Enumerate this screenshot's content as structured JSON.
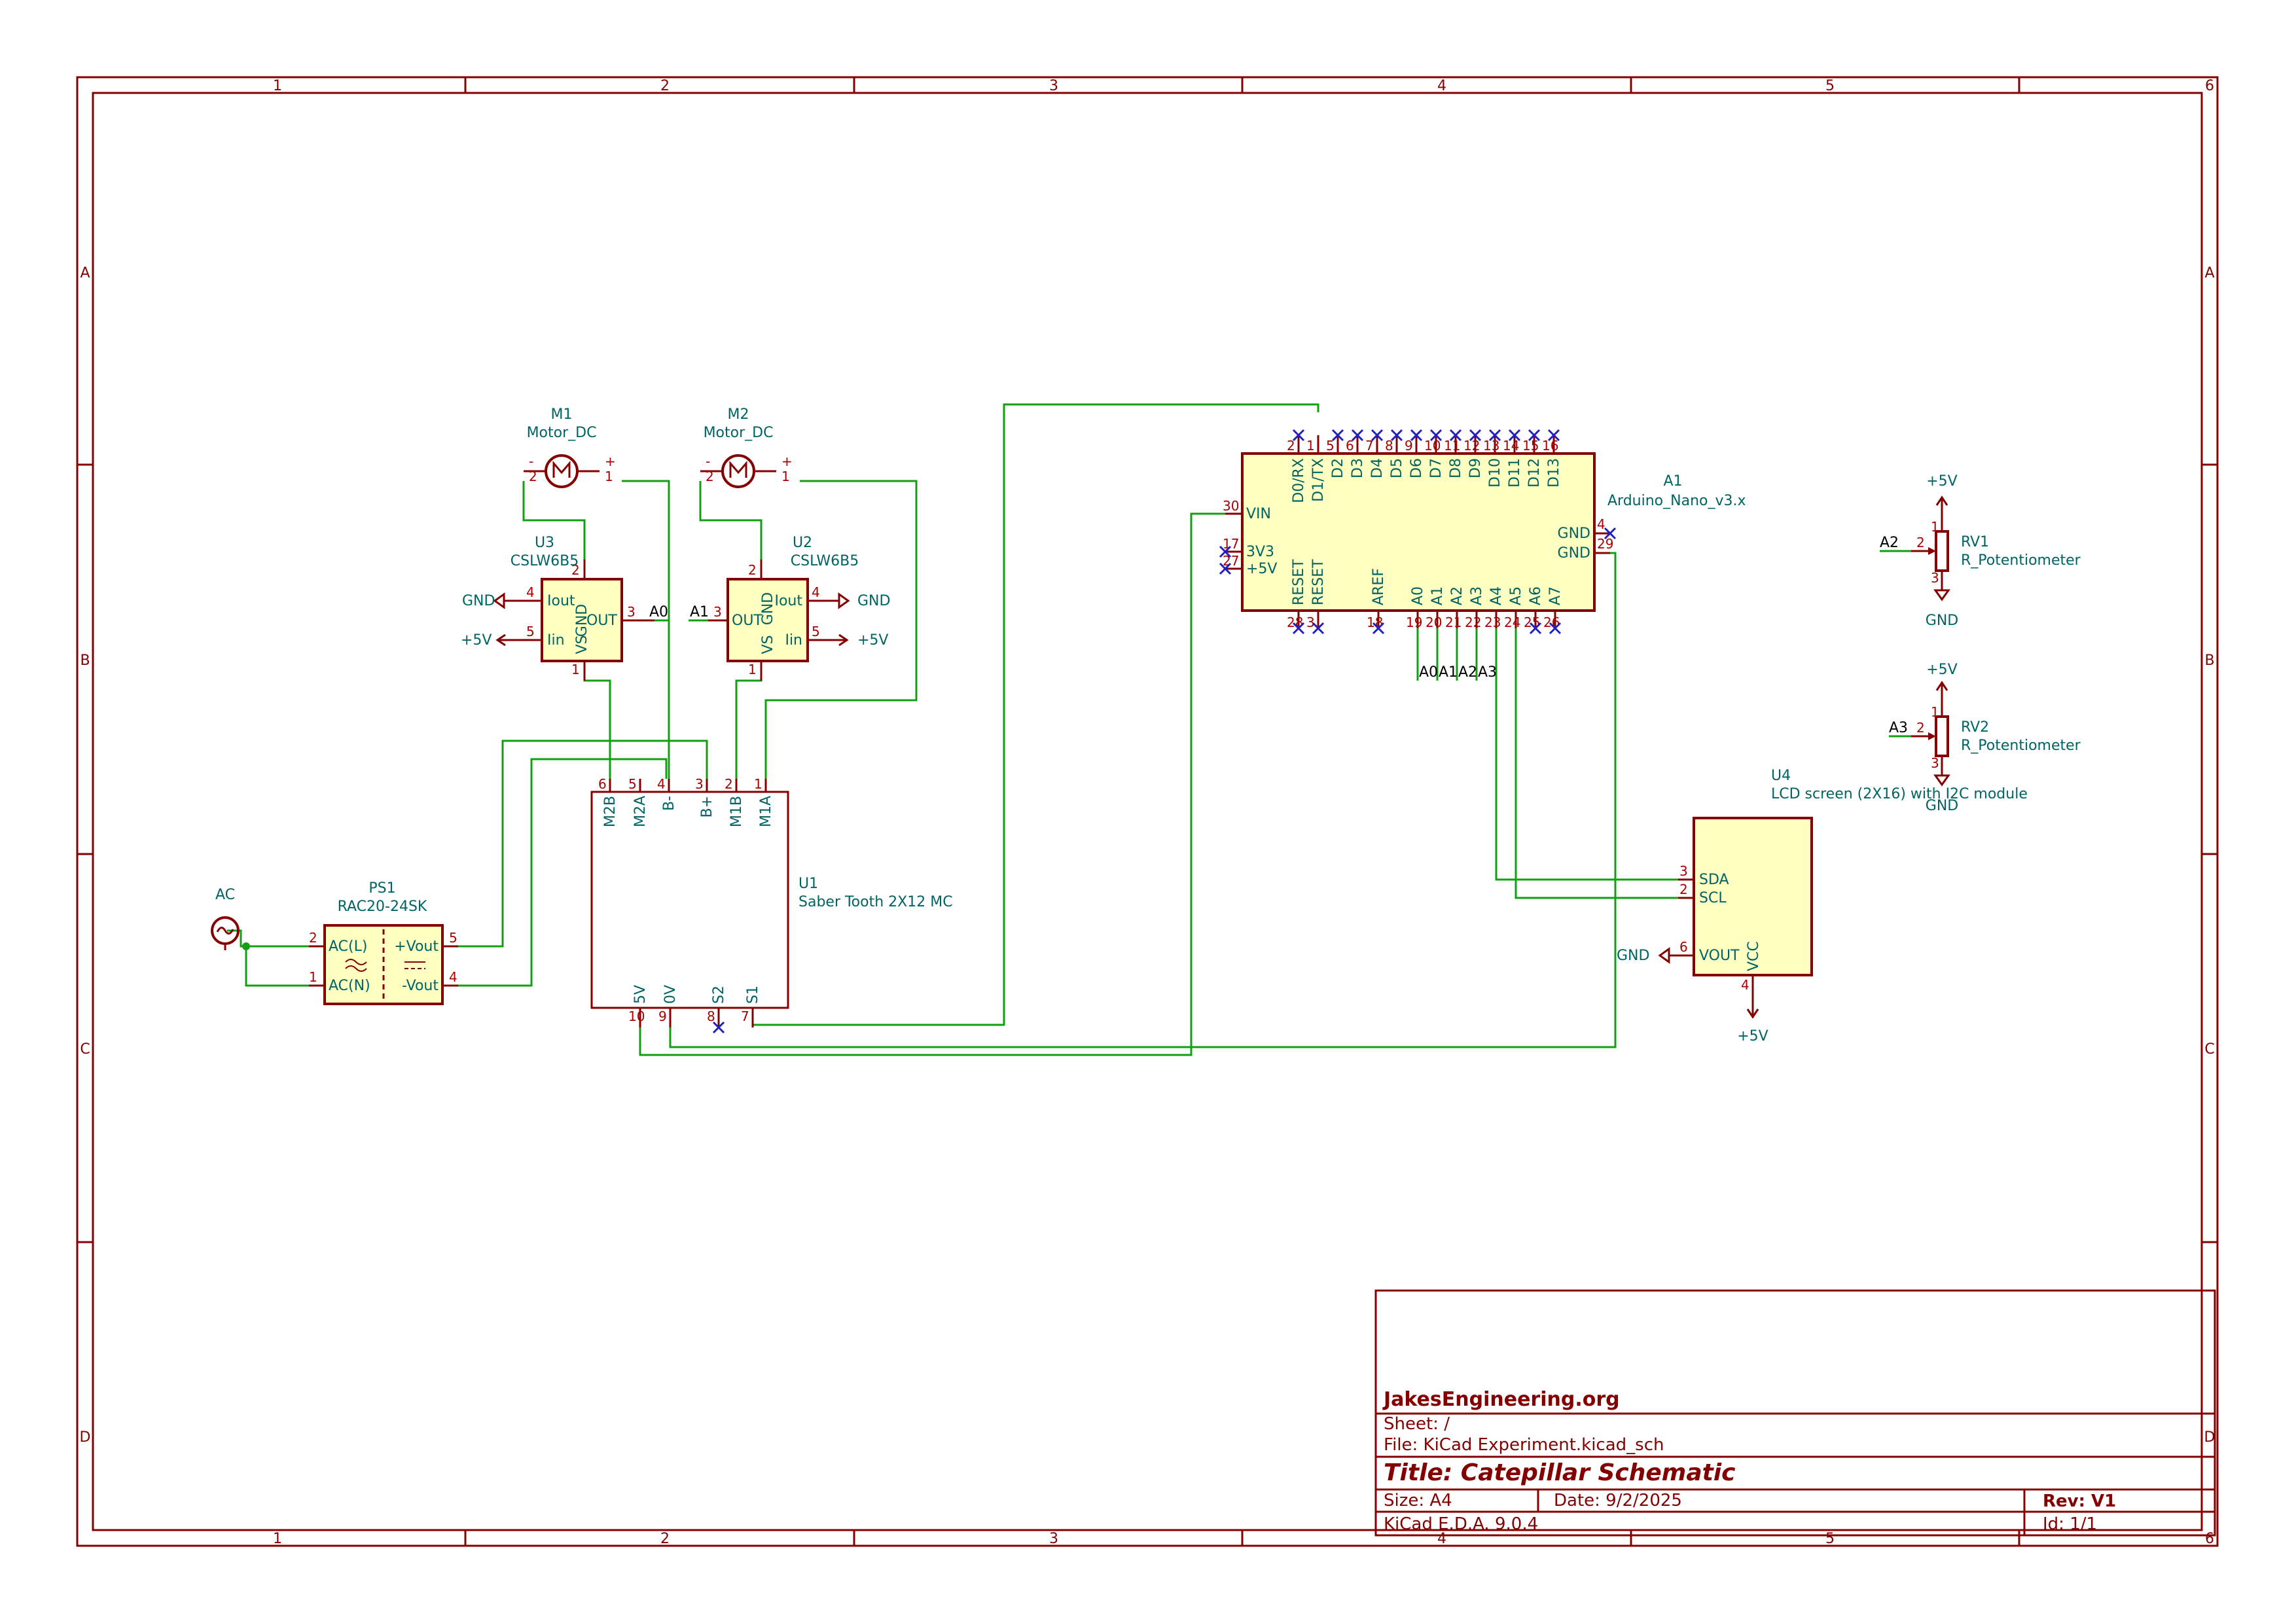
{
  "frame": {
    "columns": [
      "1",
      "2",
      "3",
      "4",
      "5",
      "6"
    ],
    "rows": [
      "A",
      "B",
      "C",
      "D"
    ]
  },
  "title_block": {
    "company": "JakesEngineering.org",
    "sheet": "Sheet: /",
    "file": "File: KiCad Experiment.kicad_sch",
    "title": "Title: Catepillar Schematic",
    "size": "Size: A4",
    "date": "Date: 9/2/2025",
    "rev": "Rev: V1",
    "tool": "KiCad E.D.A. 9.0.4",
    "id": "Id: 1/1"
  },
  "components": {
    "m1": {
      "ref": "M1",
      "value": "Motor_DC",
      "pins": {
        "minus": "2",
        "plus": "1"
      }
    },
    "m2": {
      "ref": "M2",
      "value": "Motor_DC",
      "pins": {
        "minus": "2",
        "plus": "1"
      }
    },
    "u3": {
      "ref": "U3",
      "value": "CSLW6B5",
      "pins": {
        "iout": "Iout",
        "iin": "Iin",
        "gnd": "GND",
        "vs": "VS",
        "out": "OUT"
      }
    },
    "u2": {
      "ref": "U2",
      "value": "CSLW6B5",
      "pins": {
        "iout": "Iout",
        "iin": "Iin",
        "gnd": "GND",
        "vs": "VS",
        "out": "OUT"
      }
    },
    "ps1": {
      "ref": "PS1",
      "value": "RAC20-24SK",
      "pins": {
        "acl": "AC(L)",
        "acn": "AC(N)",
        "vplus": "+Vout",
        "vminus": "-Vout"
      }
    },
    "ac": {
      "ref": "AC"
    },
    "u1": {
      "ref": "U1",
      "value": "Saber Tooth 2X12 MC",
      "top_pins": [
        "M2B",
        "M2A",
        "B-",
        "B+",
        "M1B",
        "M1A"
      ],
      "top_nums": [
        "6",
        "5",
        "4",
        "3",
        "2",
        "1"
      ],
      "bottom_pins": [
        "5V",
        "0V",
        "S2",
        "S1"
      ],
      "bottom_nums": [
        "10",
        "9",
        "8",
        "7"
      ]
    },
    "a1": {
      "ref": "A1",
      "value": "Arduino_Nano_v3.x",
      "top_pins": [
        "D0/RX",
        "D1/TX",
        "D2",
        "D3",
        "D4",
        "D5",
        "D6",
        "D7",
        "D8",
        "D9",
        "D10",
        "D11",
        "D12",
        "D13"
      ],
      "top_nums": [
        "2",
        "1",
        "5",
        "6",
        "7",
        "8",
        "9",
        "10",
        "11",
        "12",
        "13",
        "14",
        "15",
        "16"
      ],
      "bottom_pins": [
        "RESET",
        "RESET",
        "AREF",
        "A0",
        "A1",
        "A2",
        "A3",
        "A4",
        "A5",
        "A6",
        "A7"
      ],
      "bottom_nums": [
        "28",
        "3",
        "18",
        "19",
        "20",
        "21",
        "22",
        "23",
        "24",
        "25",
        "26"
      ],
      "left_pins": [
        "VIN",
        "3V3",
        "+5V"
      ],
      "left_nums": [
        "30",
        "17",
        "27"
      ],
      "right_pins": [
        "GND",
        "GND"
      ],
      "right_nums": [
        "4",
        "29"
      ]
    },
    "u4": {
      "ref": "U4",
      "value": "LCD screen (2X16) with I2C module",
      "pins": [
        "SDA",
        "SCL",
        "VOUT",
        "VCC"
      ],
      "nums": [
        "3",
        "2",
        "6",
        "4"
      ]
    },
    "rv1": {
      "ref": "RV1",
      "value": "R_Potentiometer"
    },
    "rv2": {
      "ref": "RV2",
      "value": "R_Potentiometer"
    }
  },
  "power": {
    "gnd": "GND",
    "vcc": "+5V"
  },
  "net_labels": [
    "A0",
    "A1",
    "A2",
    "A3"
  ]
}
